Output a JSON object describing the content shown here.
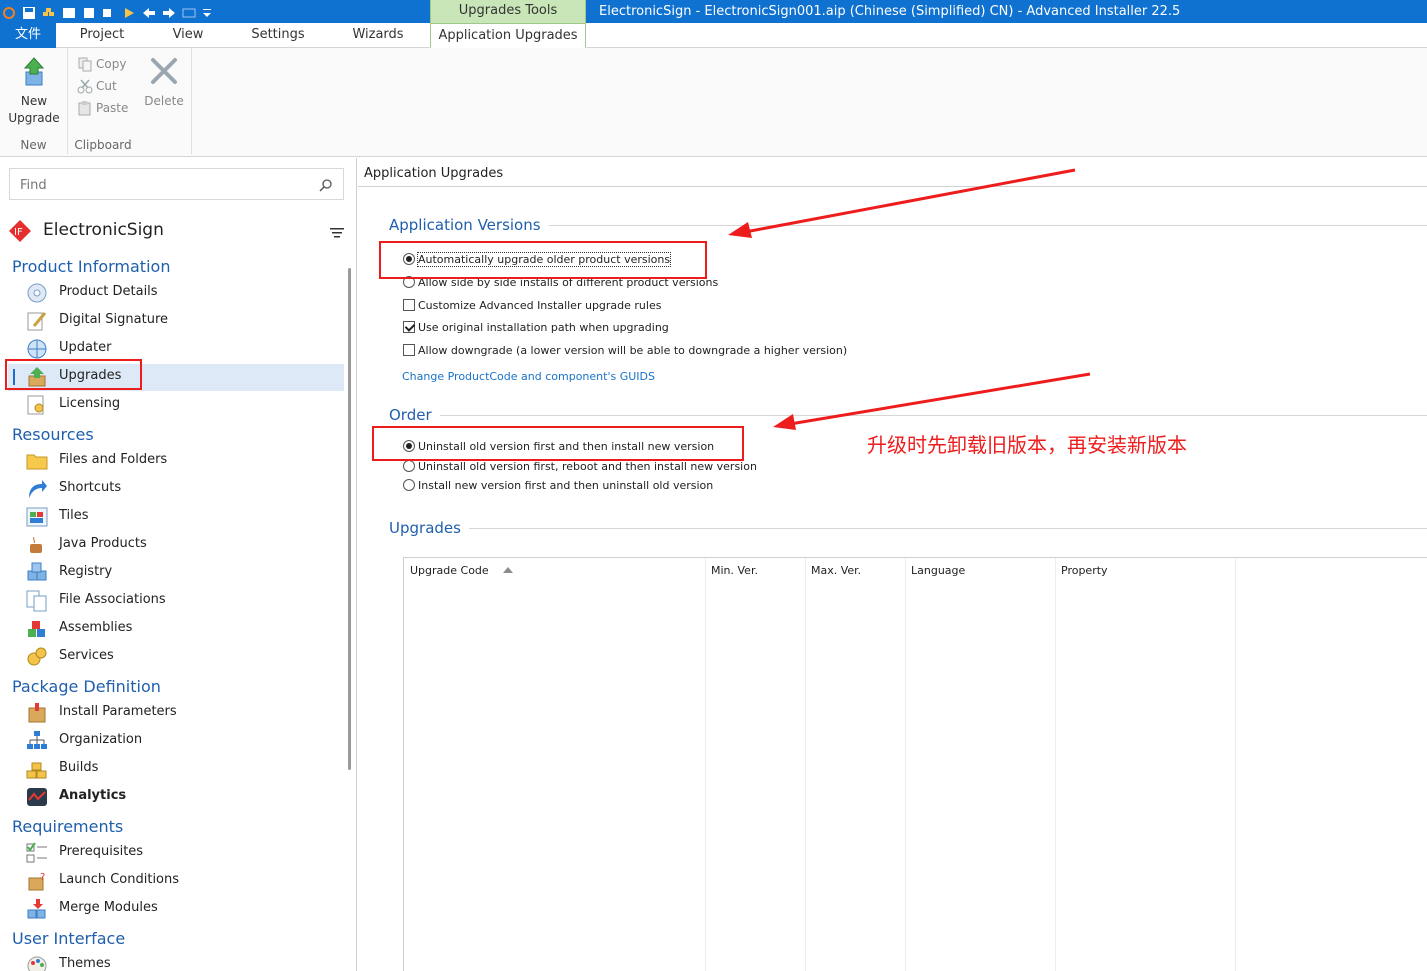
{
  "titlebar": {
    "tools_tab": "Upgrades Tools",
    "window_title": "ElectronicSign - ElectronicSign001.aip (Chinese (Simplified) CN) - Advanced Installer 22.5"
  },
  "menu": {
    "file": "文件",
    "tabs": [
      "Project",
      "View",
      "Settings",
      "Wizards"
    ],
    "active_tab": "Application Upgrades"
  },
  "ribbon": {
    "new_group_label": "New",
    "new_upgrade_line1": "New",
    "new_upgrade_line2": "Upgrade",
    "clipboard_group_label": "Clipboard",
    "copy": "Copy",
    "cut": "Cut",
    "paste": "Paste",
    "delete": "Delete"
  },
  "sidebar": {
    "find_placeholder": "Find",
    "project_name": "ElectronicSign",
    "sections": [
      {
        "title": "Product Information",
        "items": [
          "Product Details",
          "Digital Signature",
          "Updater",
          "Upgrades",
          "Licensing"
        ]
      },
      {
        "title": "Resources",
        "items": [
          "Files and Folders",
          "Shortcuts",
          "Tiles",
          "Java Products",
          "Registry",
          "File Associations",
          "Assemblies",
          "Services"
        ]
      },
      {
        "title": "Package Definition",
        "items": [
          "Install Parameters",
          "Organization",
          "Builds",
          "Analytics"
        ]
      },
      {
        "title": "Requirements",
        "items": [
          "Prerequisites",
          "Launch Conditions",
          "Merge Modules"
        ]
      },
      {
        "title": "User Interface",
        "items": [
          "Themes"
        ]
      }
    ],
    "selected_item": "Upgrades"
  },
  "main": {
    "title": "Application Upgrades",
    "app_versions": {
      "title": "Application Versions",
      "options": [
        {
          "label": "Automatically upgrade older product versions",
          "kind": "radio",
          "checked": true
        },
        {
          "label": "Allow side by side installs of different product versions",
          "kind": "radio",
          "checked": false
        },
        {
          "label": "Customize Advanced Installer upgrade rules",
          "kind": "checkbox",
          "checked": false
        },
        {
          "label": "Use original installation path when upgrading",
          "kind": "checkbox",
          "checked": true
        },
        {
          "label": "Allow downgrade (a lower version will be able to downgrade a higher version)",
          "kind": "checkbox",
          "checked": false
        }
      ],
      "link": "Change ProductCode and component's GUIDS"
    },
    "order": {
      "title": "Order",
      "options": [
        {
          "label": "Uninstall old version first and then install new version",
          "checked": true
        },
        {
          "label": "Uninstall old version first, reboot and then install new version",
          "checked": false
        },
        {
          "label": "Install new version first and then uninstall old version",
          "checked": false
        }
      ]
    },
    "upgrades": {
      "title": "Upgrades",
      "columns": [
        "Upgrade Code",
        "Min. Ver.",
        "Max. Ver.",
        "Language",
        "Property"
      ]
    }
  },
  "annotation": {
    "note": "升级时先卸载旧版本，再安装新版本",
    "color": "#ee1d1d"
  }
}
